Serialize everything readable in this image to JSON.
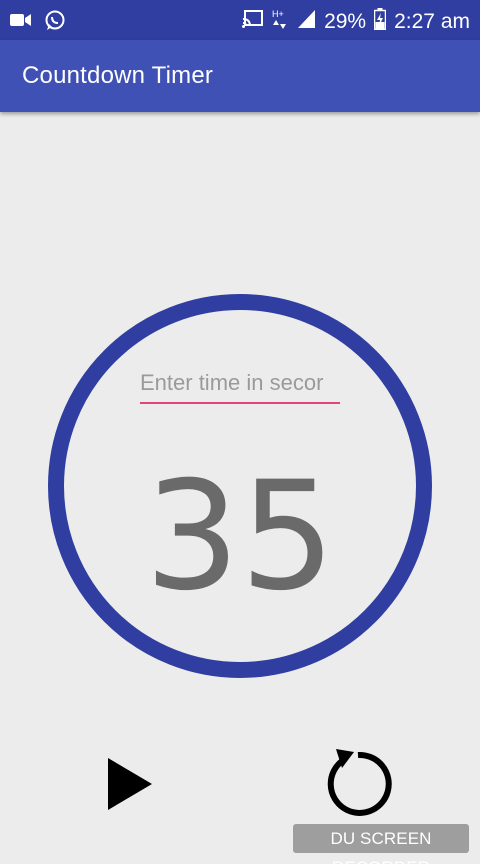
{
  "status_bar": {
    "battery_percent": "29%",
    "time": "2:27 am",
    "network_label": "H+",
    "icons": [
      "video-camera-icon",
      "whatsapp-icon",
      "cast-icon",
      "network-arrows-icon",
      "signal-icon",
      "battery-charging-icon"
    ]
  },
  "app_bar": {
    "title": "Countdown Timer"
  },
  "timer": {
    "input_placeholder": "Enter time in secor",
    "input_value": "",
    "countdown_value": "35"
  },
  "controls": {
    "play_icon": "play-icon",
    "reset_icon": "refresh-icon"
  },
  "watermark": {
    "text": "DU SCREEN RECORDER"
  },
  "colors": {
    "status_bar": "#2f3ea0",
    "app_bar": "#3f51b5",
    "ring": "#2f3ea0",
    "input_underline": "#e0457b",
    "countdown_text": "#6a6a6a",
    "background": "#ececec"
  }
}
